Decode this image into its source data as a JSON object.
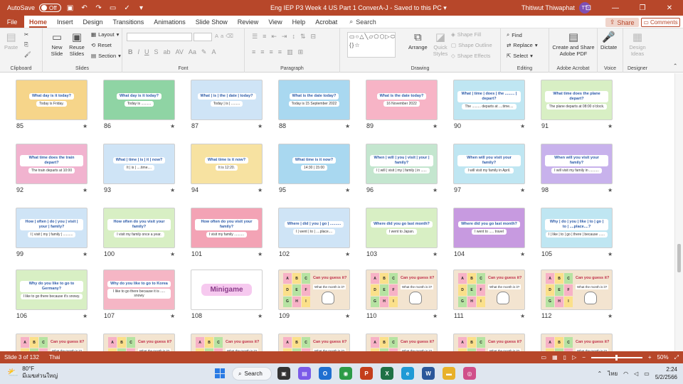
{
  "titlebar": {
    "autosave_label": "AutoSave",
    "autosave_state": "Off",
    "doc_title": "Eng IEP P3 Week 4 US Part 1 ConverA-J",
    "save_status": "Saved to this PC",
    "user_name": "Thitiwut Thiwaphat",
    "user_initials": "TT"
  },
  "menu": {
    "file": "File",
    "tabs": [
      "Home",
      "Insert",
      "Design",
      "Transitions",
      "Animations",
      "Slide Show",
      "Review",
      "View",
      "Help",
      "Acrobat"
    ],
    "search_label": "Search",
    "share_label": "Share",
    "comments_label": "Comments"
  },
  "ribbon": {
    "clipboard": {
      "paste": "Paste",
      "label": "Clipboard"
    },
    "slides": {
      "new_slide": "New Slide",
      "reuse_slides": "Reuse Slides",
      "layout": "Layout",
      "reset": "Reset",
      "section": "Section",
      "label": "Slides"
    },
    "font": {
      "label": "Font"
    },
    "paragraph": {
      "label": "Paragraph"
    },
    "drawing": {
      "arrange": "Arrange",
      "quick_styles": "Quick Styles",
      "shape_fill": "Shape Fill",
      "shape_outline": "Shape Outline",
      "shape_effects": "Shape Effects",
      "label": "Drawing"
    },
    "editing": {
      "find": "Find",
      "replace": "Replace",
      "select": "Select",
      "label": "Editing"
    },
    "acrobat": {
      "create_share": "Create and Share Adobe PDF",
      "label": "Adobe Acrobat"
    },
    "voice": {
      "dictate": "Dictate",
      "label": "Voice"
    },
    "designer": {
      "design_ideas": "Design Ideas",
      "label": "Designer"
    }
  },
  "slides": [
    {
      "num": "85",
      "q": "What day is it today?",
      "a": "Today is Friday.",
      "bg": "#f6d58a"
    },
    {
      "num": "86",
      "q": "What day is it today?",
      "a": "Today is ..........",
      "bg": "#8fd4a4"
    },
    {
      "num": "87",
      "q": "What | is | the | date | today?",
      "a": "Today | is | .........",
      "bg": "#cfe4f6"
    },
    {
      "num": "88",
      "q": "What is the date today?",
      "a": "Today is 15 September 2022",
      "bg": "#a9d8f0"
    },
    {
      "num": "89",
      "q": "What is the date today?",
      "a": "16 November 2022",
      "bg": "#f7b4c6"
    },
    {
      "num": "90",
      "q": "What | time | does | the ......... | depart?",
      "a": "The ......... departs at ....time....",
      "bg": "#bfe6f2"
    },
    {
      "num": "91",
      "q": "What time does the plane depart?",
      "a": "The plane departs at 08:00 o'clock.",
      "bg": "#d8efc4"
    },
    {
      "num": "92",
      "q": "What time does the train depart?",
      "a": "The train departs at 10:00",
      "bg": "#f1b3cf"
    },
    {
      "num": "93",
      "q": "What | time | is | it | now?",
      "a": "It | is | ....time....",
      "bg": "#cfe4f6"
    },
    {
      "num": "94",
      "q": "What time is it now?",
      "a": "It is 12:20.",
      "bg": "#f7e2a1"
    },
    {
      "num": "95",
      "q": "What time is it now?",
      "a": "14:30 | 15:00",
      "bg": "#a9d8f0"
    },
    {
      "num": "96",
      "q": "When | will | you | visit | your | family?",
      "a": "I | will | visit | my | family | in ......",
      "bg": "#c4e6cf"
    },
    {
      "num": "97",
      "q": "When will you visit your family?",
      "a": "I will visit my family in April.",
      "bg": "#bfe6f2"
    },
    {
      "num": "98",
      "q": "When will you visit your family?",
      "a": "I will visit my family in ..........",
      "bg": "#c8b2ec"
    },
    {
      "num": "99",
      "q": "How | often | do | you | visit | your | family?",
      "a": "I | visit | my | family | ..........",
      "bg": "#cfe4f6"
    },
    {
      "num": "100",
      "q": "How often do you visit your family?",
      "a": "I visit my family once a year.",
      "bg": "#d8efc4"
    },
    {
      "num": "101",
      "q": "How often do you visit your family?",
      "a": "I visit my family ..........",
      "bg": "#f3a3b5"
    },
    {
      "num": "102",
      "q": "Where | did | you | go | ..........",
      "a": "I | went | to | ....place....",
      "bg": "#cfe4f6"
    },
    {
      "num": "103",
      "q": "Where did you go last month?",
      "a": "I went to Japan.",
      "bg": "#d8efc4"
    },
    {
      "num": "104",
      "q": "Where did you go last month?",
      "a": "I went to ..... travel",
      "bg": "#c79ae0"
    },
    {
      "num": "105",
      "q": "Why | do | you | like | to | go | to | ....place....?",
      "a": "I | like | to | go | there | because ......",
      "bg": "#bfe6f2"
    },
    {
      "num": "106",
      "q": "Why do you like to go to Germany?",
      "a": "I like to go there because it's snowy.",
      "bg": "#d8efc4"
    },
    {
      "num": "107",
      "q": "Why do you like to go to Korea",
      "a": "I like to go there because it is ..... snowy",
      "bg": "#f5b6c5"
    },
    {
      "num": "108",
      "q": "Minigame",
      "a": "",
      "bg": "#ffffff"
    },
    {
      "num": "109",
      "q": "Can you guess it?",
      "a": "What the month is it?",
      "bg": "#f3e4d0"
    },
    {
      "num": "110",
      "q": "Can you guess it?",
      "a": "What the month is it?",
      "bg": "#f3e4d0"
    },
    {
      "num": "111",
      "q": "Can you guess it?",
      "a": "What the month is it?",
      "bg": "#f3e4d0"
    },
    {
      "num": "112",
      "q": "Can you guess it?",
      "a": "What the month is it?",
      "bg": "#f3e4d0"
    }
  ],
  "guess_grid": [
    "A",
    "B",
    "C",
    "D",
    "E",
    "F",
    "G",
    "H",
    "I"
  ],
  "status": {
    "slide_of": "Slide 3 of 132",
    "language": "Thai",
    "zoom": "50%"
  },
  "taskbar": {
    "temperature": "80°F",
    "weather_desc": "มีเมฆส่วนใหญ่",
    "search_label": "Search",
    "language": "ไทย",
    "time": "2:24",
    "date": "5/2/2566"
  },
  "colors": {
    "accent": "#b7472a",
    "taskbar": "#dfe6ef"
  }
}
